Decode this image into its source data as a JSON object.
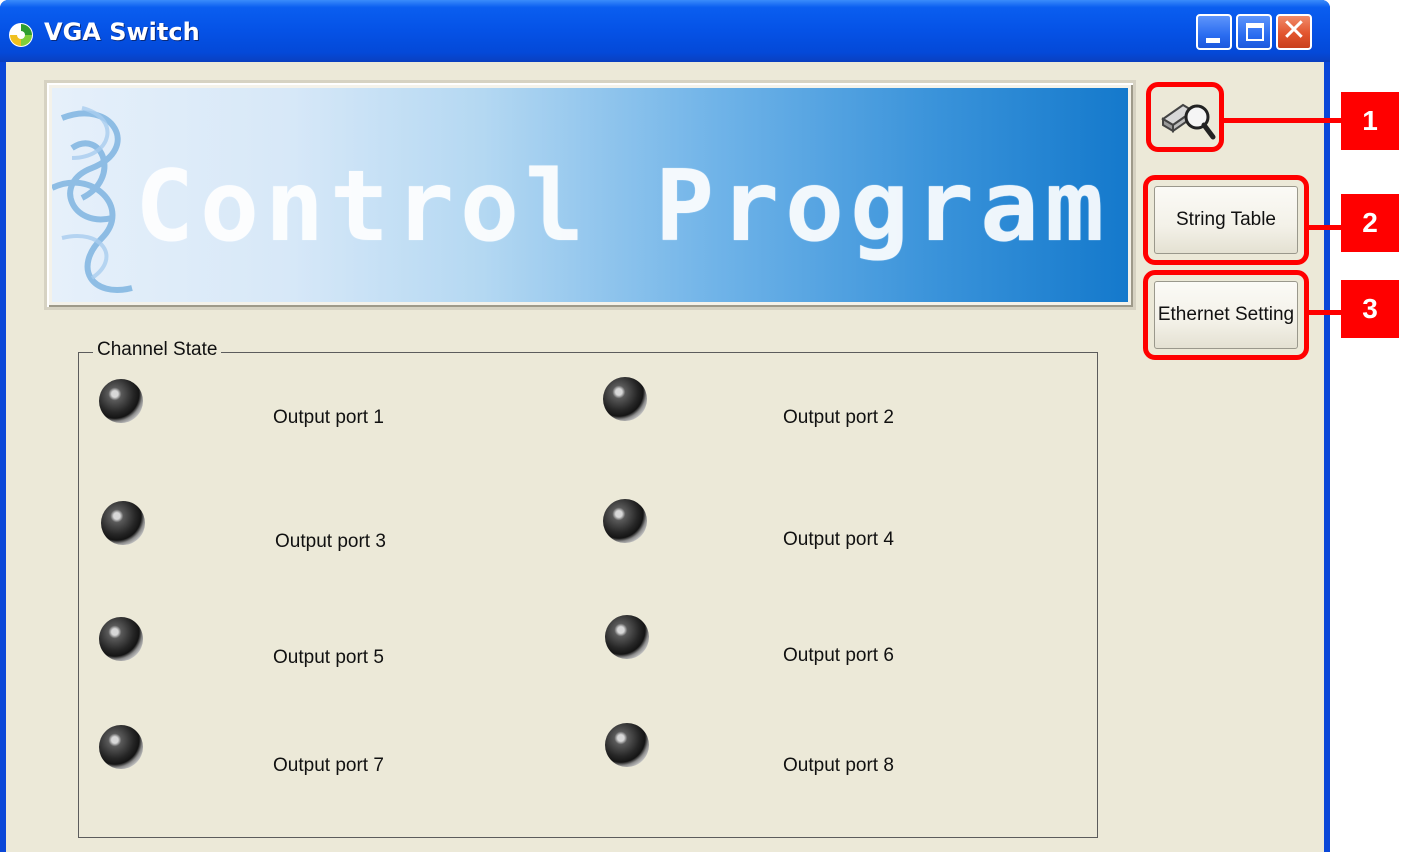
{
  "window": {
    "title": "VGA Switch"
  },
  "banner": {
    "text": "Control Program"
  },
  "sidebar": {
    "string_table_label": "String Table",
    "ethernet_setting_label": "Ethernet Setting"
  },
  "callouts": [
    "1",
    "2",
    "3"
  ],
  "channel_state": {
    "label": "Channel State",
    "ports": [
      {
        "label": "Output port 1"
      },
      {
        "label": "Output port 2"
      },
      {
        "label": "Output port 3"
      },
      {
        "label": "Output port 4"
      },
      {
        "label": "Output port 5"
      },
      {
        "label": "Output port 6"
      },
      {
        "label": "Output port 7"
      },
      {
        "label": "Output port 8"
      }
    ]
  },
  "colors": {
    "callout": "#ff0000",
    "titlebar": "#0552e6",
    "client_bg": "#ece9d8"
  }
}
